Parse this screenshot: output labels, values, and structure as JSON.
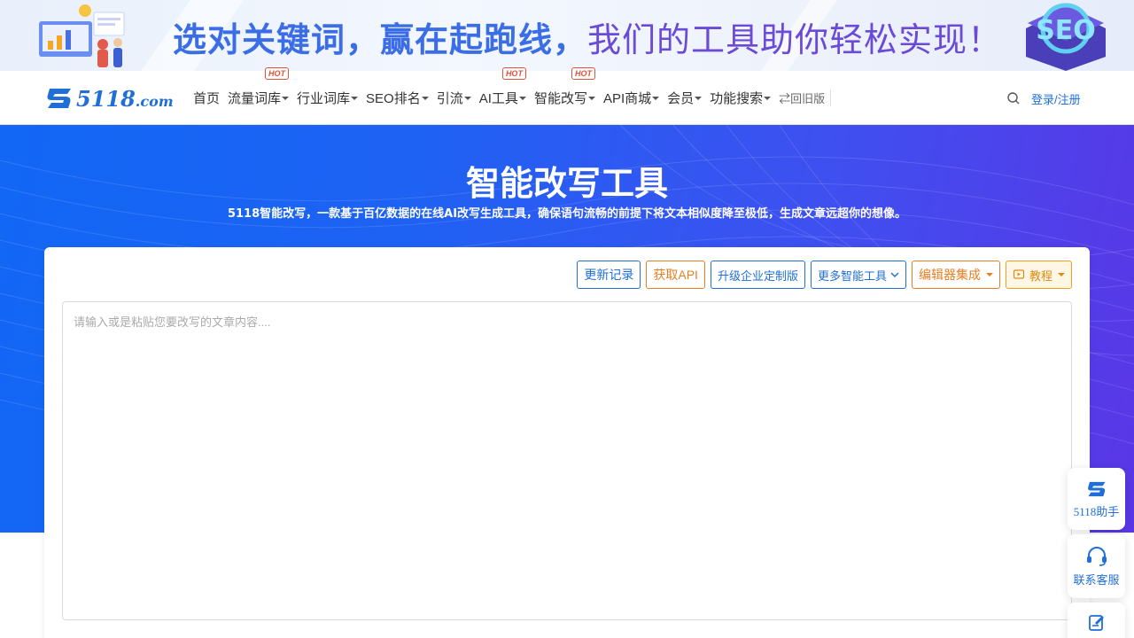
{
  "banner": {
    "slogan_a": "选对关键词，赢在起跑线，",
    "slogan_b": "我们的工具助你轻松实现！",
    "badge": "SEO"
  },
  "navbar": {
    "logo_number": "5118",
    "logo_domain": ".com",
    "items": [
      {
        "label": "首页",
        "caret": false,
        "hot": ""
      },
      {
        "label": "流量词库",
        "caret": true,
        "hot": "HOT"
      },
      {
        "label": "行业词库",
        "caret": true,
        "hot": ""
      },
      {
        "label": "SEO排名",
        "caret": true,
        "hot": ""
      },
      {
        "label": "引流",
        "caret": true,
        "hot": ""
      },
      {
        "label": "AI工具",
        "caret": true,
        "hot": "HOT"
      },
      {
        "label": "智能改写",
        "caret": true,
        "hot": "HOT"
      },
      {
        "label": "API商城",
        "caret": true,
        "hot": ""
      },
      {
        "label": "会员",
        "caret": true,
        "hot": ""
      },
      {
        "label": "功能搜索",
        "caret": true,
        "hot": ""
      }
    ],
    "old_version": "⇄回旧版",
    "login": "登录/注册"
  },
  "hero": {
    "title": "智能改写工具",
    "subtitle": "5118智能改写，一款基于百亿数据的在线AI改写生成工具，确保语句流畅的前提下将文本相似度降至极低，生成文章远超你的想像。"
  },
  "toolbar": {
    "changelog": "更新记录",
    "get_api": "获取API",
    "enterprise": "升级企业定制版",
    "more_tools": "更多智能工具",
    "editor_integration": "编辑器集成",
    "tutorial": "教程"
  },
  "editor": {
    "placeholder": "请输入或是粘贴您要改写的文章内容....",
    "value": ""
  },
  "floating": {
    "assistant": "5118助手",
    "support": "联系客服"
  },
  "colors": {
    "brand_blue": "#1f6fd6",
    "hero_start": "#1267f5",
    "hero_end": "#5a36e6",
    "accent_orange": "#e67e22",
    "hot_red": "#e0523c"
  }
}
